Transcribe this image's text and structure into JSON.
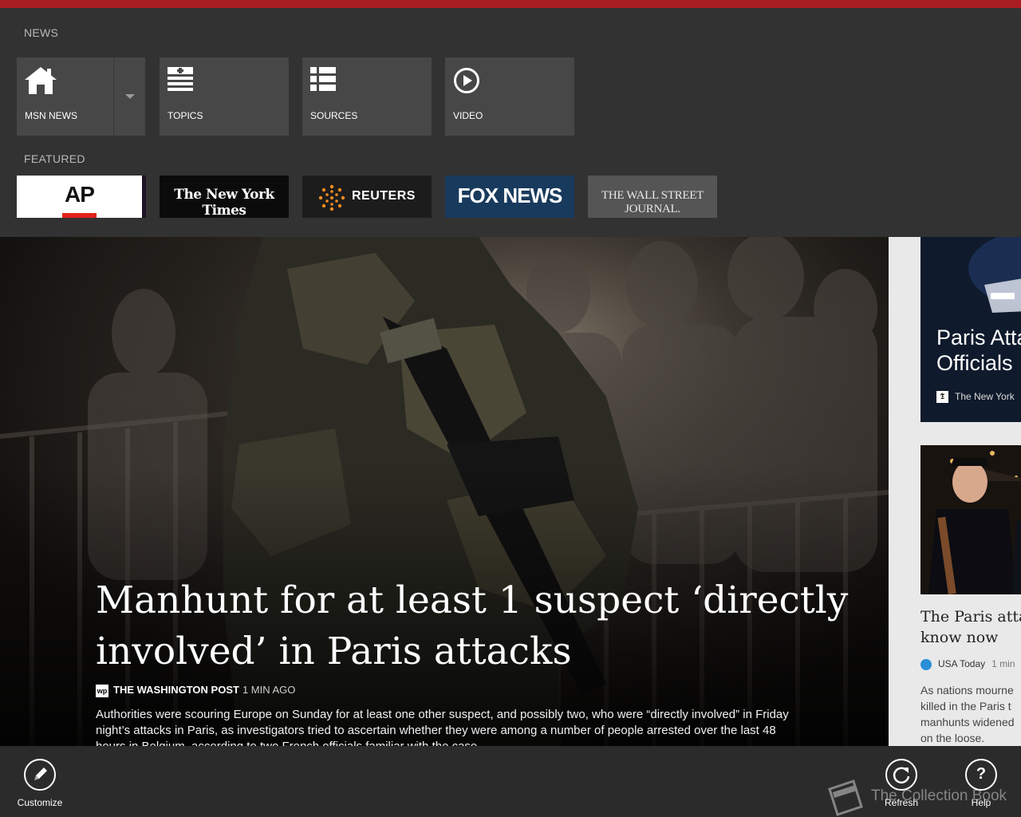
{
  "nav": {
    "news_label": "NEWS",
    "featured_label": "FEATURED",
    "tiles": [
      {
        "label": "MSN NEWS",
        "icon": "home-icon"
      },
      {
        "label": "TOPICS",
        "icon": "topics-icon"
      },
      {
        "label": "SOURCES",
        "icon": "list-icon"
      },
      {
        "label": "VIDEO",
        "icon": "play-icon"
      }
    ],
    "featured_sources": [
      {
        "logo_text": "AP"
      },
      {
        "logo_text": "The New York Times"
      },
      {
        "logo_text": "REUTERS"
      },
      {
        "logo_text": "FOX NEWS"
      },
      {
        "logo_text": "THE WALL STREET JOURNAL."
      }
    ]
  },
  "hero": {
    "headline": "Manhunt for at least 1 suspect ‘directly involved’ in Paris attacks",
    "source": "THE WASHINGTON POST",
    "source_icon_text": "wp",
    "time": "1 MIN AGO",
    "summary": "Authorities were scouring Europe on Sunday for at least one other suspect, and possibly two, who were “directly involved” in Friday night’s attacks in Paris, as investigators tried to ascertain whether they were among a number of people arrested over the last 48 hours in Belgium, according to two French officials familiar with the case."
  },
  "side": {
    "card1": {
      "title_line1": "Paris Atta",
      "title_line2": "Officials",
      "source": "The New York"
    },
    "card2": {
      "title_line1": "The Paris atta",
      "title_line2": "know now",
      "source": "USA Today",
      "time": "1 min",
      "body": [
        "As nations mourne",
        "killed in the Paris t",
        "manhunts widened",
        "on the loose."
      ]
    }
  },
  "appbar": {
    "customize": "Customize",
    "refresh": "Refresh",
    "help": "Help",
    "help_glyph": "?"
  },
  "watermark": "The Collection Book",
  "colors": {
    "accent": "#a91d22",
    "nav_bg": "#323232",
    "tile_bg": "#474747",
    "fox_blue": "#183a5c"
  }
}
